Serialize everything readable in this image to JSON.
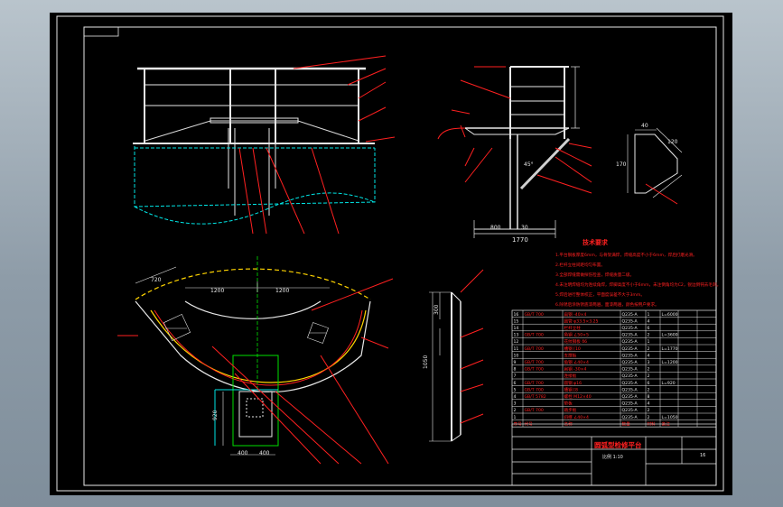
{
  "drawing": {
    "tech_title": "技术要求",
    "tech_lines": [
      "1.平台钢板厚度6mm，与骨架满焊，焊缝高度不小于6mm，焊后打磨光滑。",
      "2.栏杆立柱间距均匀布置。",
      "3.全部焊缝需做探伤检查，焊缝质量二级。",
      "4.未注明焊缝均为连续角焊，焊脚高度不小于6mm，未注倒角均为C2，锐边倒钝去毛刺。",
      "5.焊后进行整体校正，平面度误差不大于3mm。",
      "6.除锈后涂防锈底漆两遍，面漆两遍，颜色按用户要求。"
    ],
    "dims": {
      "d1770": "1770",
      "d800": "800",
      "d30": "30",
      "d1200a": "1200",
      "d1200b": "1200",
      "d720": "720",
      "d400a": "400",
      "d400b": "400",
      "d920": "920",
      "d1050": "1050",
      "d300": "300",
      "d170": "170",
      "d120": "120",
      "d40": "40",
      "d45": "45°"
    },
    "title_block": {
      "name": "圆弧型检修平台",
      "scale": "比例 1:10",
      "part_count": "16",
      "header_labels": [
        "序号",
        "代号",
        "名称",
        "数量",
        "材料",
        "备注"
      ]
    },
    "bom_rows": [
      [
        "16",
        "GB/T 700",
        "扁钢 -40×4",
        "Q235-A",
        "1",
        "L=6000",
        "",
        ""
      ],
      [
        "15",
        "",
        "圆管 φ33.5×3.25",
        "Q235-A",
        "4",
        "",
        "",
        ""
      ],
      [
        "14",
        "",
        "栏杆立柱",
        "Q235-A",
        "6",
        "",
        "",
        ""
      ],
      [
        "13",
        "GB/T 700",
        "角钢 ∠50×5",
        "Q235-A",
        "2",
        "L=3600",
        "",
        ""
      ],
      [
        "12",
        "",
        "花纹钢板 δ6",
        "Q235-A",
        "1",
        "",
        "",
        ""
      ],
      [
        "11",
        "GB/T 700",
        "槽钢 [10",
        "Q235-A",
        "2",
        "L=1770",
        "",
        ""
      ],
      [
        "10",
        "",
        "支撑板",
        "Q235-A",
        "4",
        "",
        "",
        ""
      ],
      [
        "9",
        "GB/T 700",
        "角钢 ∠40×4",
        "Q235-A",
        "3",
        "L=1200",
        "",
        ""
      ],
      [
        "8",
        "GB/T 700",
        "扁钢 -30×4",
        "Q235-A",
        "2",
        "",
        "",
        ""
      ],
      [
        "7",
        "",
        "连接板",
        "Q235-A",
        "2",
        "",
        "",
        ""
      ],
      [
        "6",
        "GB/T 700",
        "圆钢 φ16",
        "Q235-A",
        "6",
        "L=920",
        "",
        ""
      ],
      [
        "5",
        "GB/T 700",
        "槽钢 [8",
        "Q235-A",
        "2",
        "",
        "",
        ""
      ],
      [
        "4",
        "GB/T 5782",
        "螺栓 M12×40",
        "Q235-A",
        "8",
        "",
        "",
        ""
      ],
      [
        "3",
        "",
        "垫板",
        "Q235-A",
        "4",
        "",
        "",
        ""
      ],
      [
        "2",
        "GB/T 700",
        "踏步板",
        "Q235-A",
        "2",
        "",
        "",
        ""
      ],
      [
        "1",
        "",
        "斜撑 ∠40×4",
        "Q235-A",
        "2",
        "L=1050",
        "",
        ""
      ]
    ]
  }
}
